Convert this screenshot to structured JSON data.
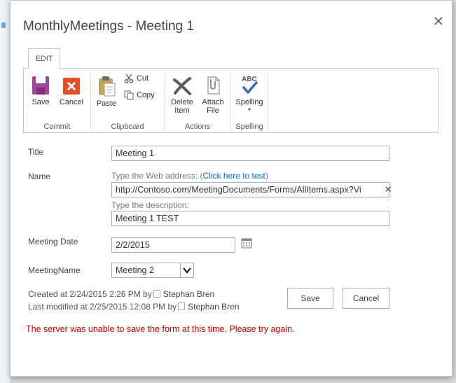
{
  "dialog": {
    "title": "MonthlyMeetings - Meeting 1"
  },
  "ribbon": {
    "tab_label": "EDIT",
    "groups": {
      "commit": {
        "name": "Commit",
        "save_label": "Save",
        "cancel_label": "Cancel"
      },
      "clipboard": {
        "name": "Clipboard",
        "paste_label": "Paste",
        "cut_label": "Cut",
        "copy_label": "Copy"
      },
      "actions": {
        "name": "Actions",
        "delete_label_1": "Delete",
        "delete_label_2": "Item",
        "attach_label_1": "Attach",
        "attach_label_2": "File"
      },
      "spelling": {
        "name": "Spelling",
        "spelling_label": "Spelling",
        "icon_text": "ABC"
      }
    }
  },
  "form": {
    "title_label": "Title",
    "title_value": "Meeting 1",
    "name_label": "Name",
    "web_address_hint": "Type the Web address: (",
    "test_link": "Click here to test",
    "web_address_hint_end": ")",
    "url_value": "http://Contoso.com/MeetingDocuments/Forms/AllItems.aspx?Vi",
    "description_hint": "Type the description:",
    "description_value": "Meeting 1 TEST",
    "date_label": "Meeting Date",
    "date_value": "2/2/2015",
    "meeting_name_label": "MeetingName",
    "meeting_name_value": "Meeting 2"
  },
  "meta": {
    "created_prefix": "Created at 2/24/2015 2:26 PM  by",
    "created_user": "Stephan Bren",
    "modified_prefix": "Last modified at 2/25/2015 12:08 PM  by",
    "modified_user": "Stephan Bren"
  },
  "buttons": {
    "save": "Save",
    "cancel": "Cancel"
  },
  "error_message": "The server was unable to save the form at this time. Please try again.",
  "colors": {
    "accent": "#0072c6",
    "error": "#c00000",
    "save_icon": "#a0469b",
    "cancel_icon": "#e34f26"
  }
}
